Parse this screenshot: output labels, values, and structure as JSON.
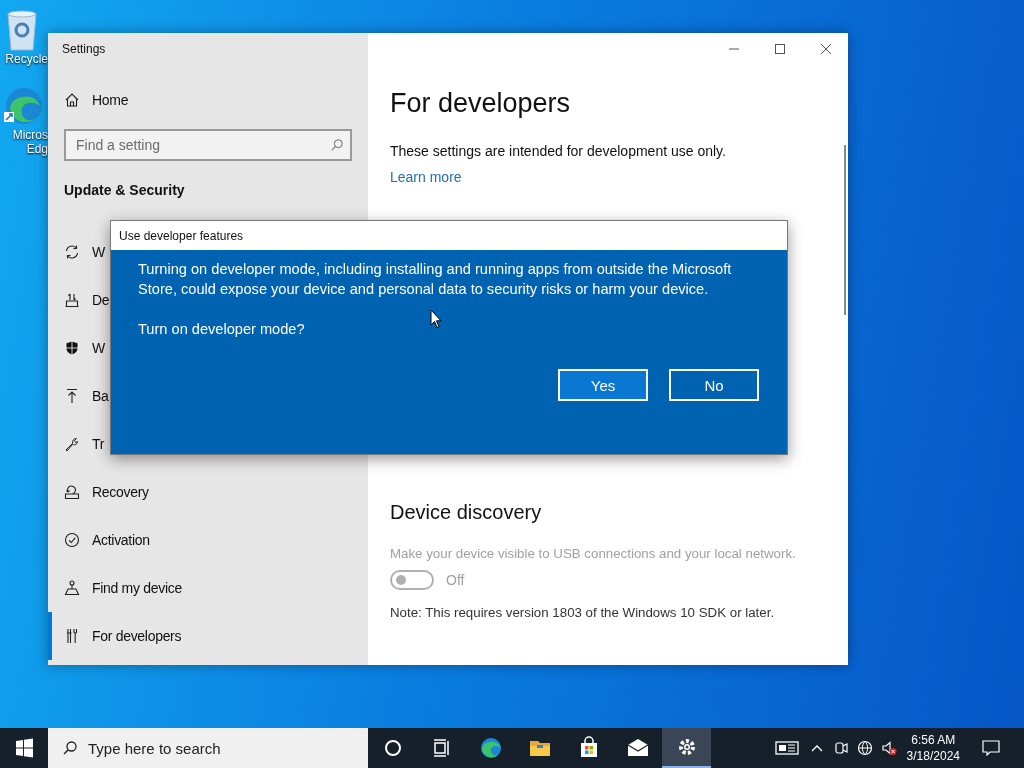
{
  "desktop_icons": [
    {
      "lines": [
        "Recycle"
      ]
    },
    {
      "lines": [
        "Micros",
        "Edg"
      ]
    }
  ],
  "window": {
    "title": "Settings"
  },
  "sidebar": {
    "home": "Home",
    "search": {
      "placeholder": "Find a setting"
    },
    "section": "Update & Security",
    "items": [
      {
        "label": "W",
        "selected": false
      },
      {
        "label": "De",
        "selected": false
      },
      {
        "label": "W",
        "selected": false
      },
      {
        "label": "Ba",
        "selected": false
      },
      {
        "label": "Tr",
        "selected": false
      },
      {
        "label": "Recovery",
        "selected": false
      },
      {
        "label": "Activation",
        "selected": false
      },
      {
        "label": "Find my device",
        "selected": false
      },
      {
        "label": "For developers",
        "selected": true
      }
    ]
  },
  "content": {
    "title": "For developers",
    "intro": "These settings are intended for development use only.",
    "link": "Learn more",
    "sections": [
      {
        "heading": "Device discovery",
        "description": "Make your device visible to USB connections and your local network.",
        "disabled": true,
        "toggle": {
          "on": false,
          "label": "Off"
        },
        "note": "Note: This requires version 1803 of the Windows 10 SDK or later."
      }
    ]
  },
  "dialog": {
    "title": "Use developer features",
    "message": "Turning on developer mode, including installing and running apps from outside the Microsoft Store, could expose your device and personal data to security risks or harm your device.",
    "question": "Turn on developer mode?",
    "buttons": [
      {
        "label": "Yes",
        "selected": true
      },
      {
        "label": "No",
        "selected": false
      }
    ]
  },
  "taskbar": {
    "search_placeholder": "Type here to search",
    "apps": [
      {
        "active": false
      },
      {
        "active": false
      },
      {
        "active": false
      },
      {
        "active": false
      },
      {
        "active": false
      },
      {
        "active": false
      },
      {
        "active": true
      }
    ],
    "clock": {
      "time": "6:56 AM",
      "date": "3/18/2024"
    }
  }
}
